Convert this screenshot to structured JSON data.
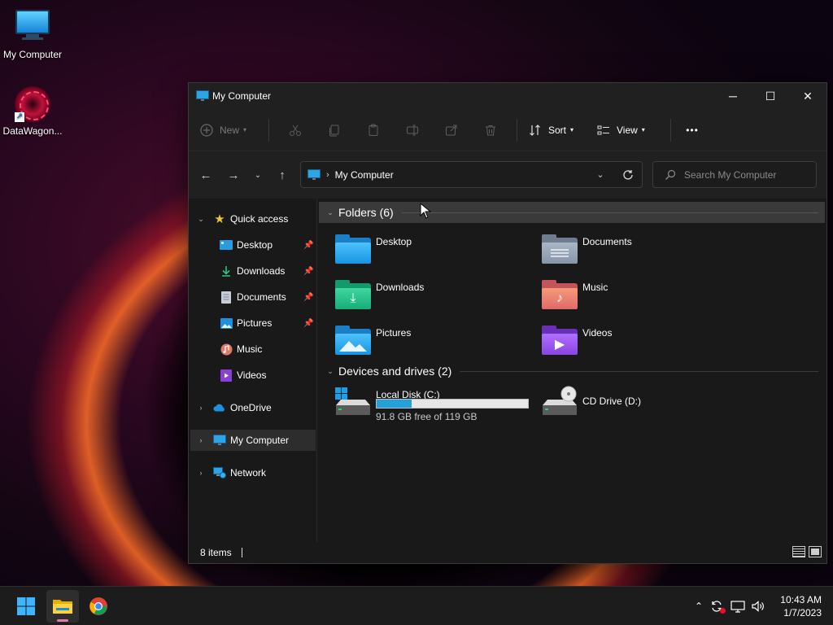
{
  "desktop": {
    "icons": [
      {
        "label": "My Computer",
        "icon": "monitor-icon"
      },
      {
        "label": "DataWagon...",
        "icon": "datawagon-logo-icon"
      }
    ]
  },
  "window": {
    "title": "My Computer",
    "controls": {
      "minimize": "─",
      "maximize": "☐",
      "close": "✕"
    }
  },
  "toolbar": {
    "new_label": "New",
    "sort_label": "Sort",
    "view_label": "View",
    "more_label": "•••"
  },
  "address": {
    "path": "My Computer",
    "search_placeholder": "Search My Computer"
  },
  "sidebar": {
    "quick_access": "Quick access",
    "items": [
      {
        "label": "Desktop",
        "pinned": true
      },
      {
        "label": "Downloads",
        "pinned": true
      },
      {
        "label": "Documents",
        "pinned": true
      },
      {
        "label": "Pictures",
        "pinned": true
      },
      {
        "label": "Music",
        "pinned": false
      },
      {
        "label": "Videos",
        "pinned": false
      }
    ],
    "onedrive": "OneDrive",
    "my_computer": "My Computer",
    "network": "Network"
  },
  "content": {
    "folders_header": "Folders (6)",
    "folders": [
      {
        "label": "Desktop",
        "icon": "desktop-folder-icon"
      },
      {
        "label": "Documents",
        "icon": "documents-folder-icon"
      },
      {
        "label": "Downloads",
        "icon": "downloads-folder-icon"
      },
      {
        "label": "Music",
        "icon": "music-folder-icon"
      },
      {
        "label": "Pictures",
        "icon": "pictures-folder-icon"
      },
      {
        "label": "Videos",
        "icon": "videos-folder-icon"
      }
    ],
    "drives_header": "Devices and drives (2)",
    "drives": [
      {
        "label": "Local Disk (C:)",
        "free_text": "91.8 GB free of 119 GB",
        "used_fraction": 0.229
      },
      {
        "label": "CD Drive (D:)"
      }
    ]
  },
  "status": {
    "items_count": "8 items"
  },
  "taskbar": {
    "apps": [
      "start-icon",
      "file-explorer-icon",
      "chrome-icon"
    ],
    "time": "10:43 AM",
    "date": "1/7/2023"
  },
  "colors": {
    "accent": "#26a0da",
    "window_bg": "#191919",
    "chrome_bg": "#202020"
  }
}
